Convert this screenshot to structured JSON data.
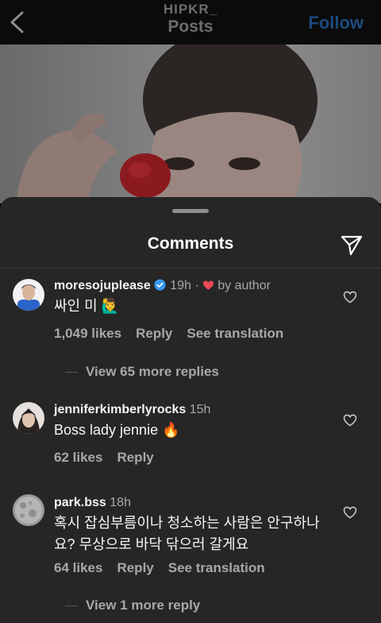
{
  "header": {
    "username": "HIPKR_",
    "title": "Posts",
    "follow_label": "Follow"
  },
  "sheet": {
    "title": "Comments"
  },
  "comments": [
    {
      "username": "moresojuplease",
      "verified": true,
      "time": "19h",
      "liked_by": "by author",
      "text": "싸인 미 🙋‍♂️",
      "likes": "1,049 likes",
      "reply_label": "Reply",
      "translation_label": "See translation",
      "more_replies": "View 65 more replies"
    },
    {
      "username": "jenniferkimberlyrocks",
      "time": "15h",
      "text": "Boss lady jennie 🔥",
      "likes": "62 likes",
      "reply_label": "Reply"
    },
    {
      "username": "park.bss",
      "time": "18h",
      "text": "혹시 잡심부름이나 청소하는 사람은 안구하나요? 무상으로 바닥 닦으러 갈게요",
      "likes": "64 likes",
      "reply_label": "Reply",
      "translation_label": "See translation",
      "more_replies": "View 1 more reply"
    }
  ],
  "colors": {
    "sheet_bg": "#262626",
    "verified": "#3897f0",
    "heart": "#ed4956",
    "muted_text": "#a8a8a8"
  },
  "icons": [
    "back-chevron-icon",
    "send-icon",
    "verified-icon",
    "heart-icon",
    "like-heart-outline-icon"
  ]
}
